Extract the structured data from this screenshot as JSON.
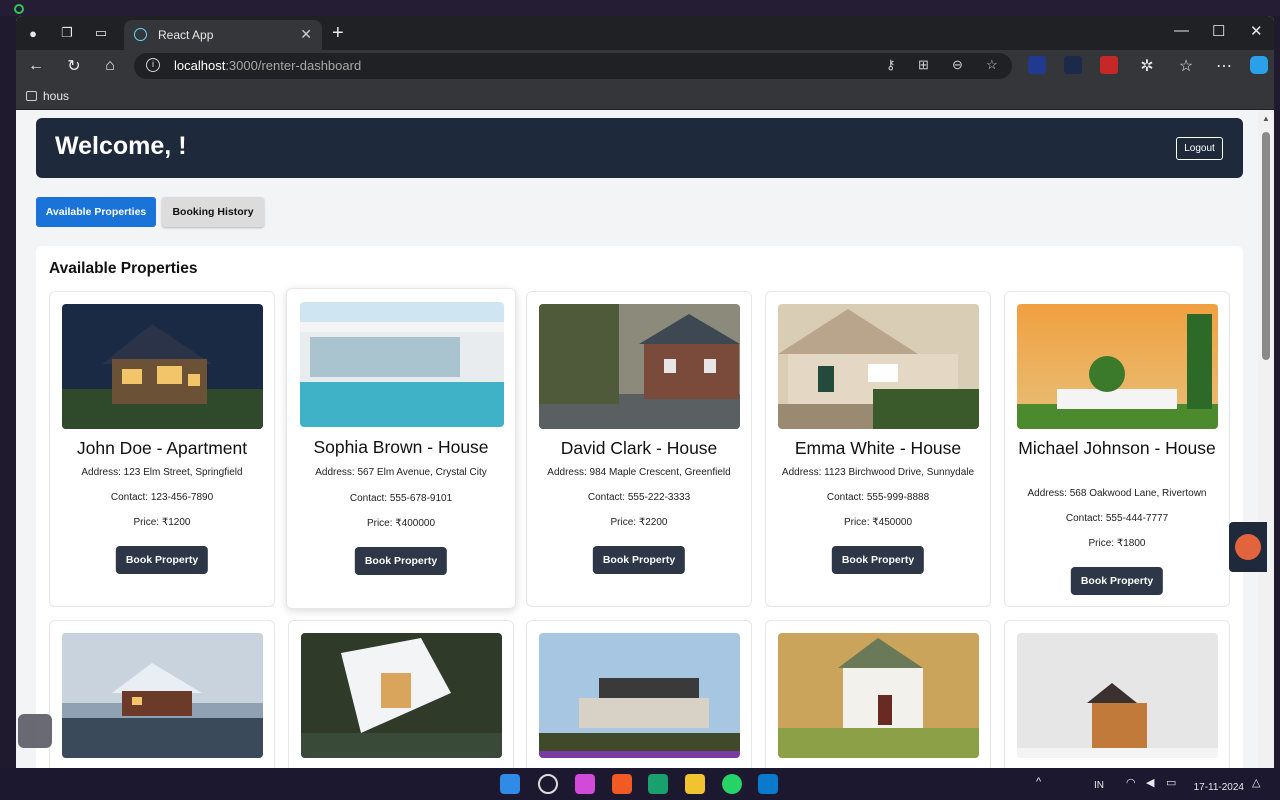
{
  "browser": {
    "tab_title": "React App",
    "url_host": "localhost",
    "url_path": ":3000/renter-dashboard",
    "bookmark": "hous"
  },
  "header": {
    "welcome": "Welcome, !",
    "logout_label": "Logout"
  },
  "tabs": {
    "available_label": "Available Properties",
    "history_label": "Booking History"
  },
  "section_title": "Available Properties",
  "book_label": "Book Property",
  "properties": [
    {
      "name": "John Doe - Apartment",
      "address": "Address: 123 Elm Street, Springfield",
      "contact": "Contact: 123-456-7890",
      "price": "Price: ₹1200"
    },
    {
      "name": "Sophia Brown - House",
      "address": "Address: 567 Elm Avenue, Crystal City",
      "contact": "Contact: 555-678-9101",
      "price": "Price: ₹400000"
    },
    {
      "name": "David Clark - House",
      "address": "Address: 984 Maple Crescent, Greenfield",
      "contact": "Contact: 555-222-3333",
      "price": "Price: ₹2200"
    },
    {
      "name": "Emma White - House",
      "address": "Address: 1123 Birchwood Drive, Sunnydale",
      "contact": "Contact: 555-999-8888",
      "price": "Price: ₹450000"
    },
    {
      "name": "Michael Johnson - House",
      "address": "Address: 568 Oakwood Lane, Rivertown",
      "contact": "Contact: 555-444-7777",
      "price": "Price: ₹1800"
    }
  ],
  "taskbar": {
    "region": "IN",
    "date": "17-11-2024"
  },
  "colors": {
    "header_bg": "#1e293b",
    "active_tab": "#1a73d9",
    "book_button": "#2d3748"
  }
}
